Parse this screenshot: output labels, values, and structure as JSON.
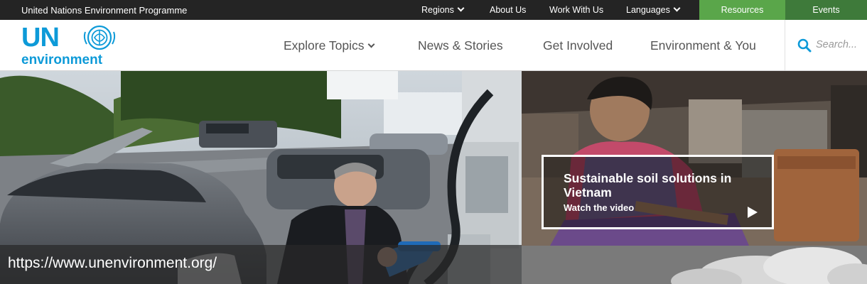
{
  "topbar": {
    "org_name": "United Nations Environment Programme",
    "nav": [
      {
        "label": "Regions",
        "has_dropdown": true
      },
      {
        "label": "About Us",
        "has_dropdown": false
      },
      {
        "label": "Work With Us",
        "has_dropdown": false
      },
      {
        "label": "Languages",
        "has_dropdown": true
      }
    ],
    "resources_label": "Resources",
    "events_label": "Events",
    "resources_color": "#5aa64a",
    "events_color": "#3e7a3a"
  },
  "header": {
    "logo_un": "UN",
    "logo_environment": "environment",
    "brand_color": "#0d9ad8",
    "nav": [
      {
        "label": "Explore Topics",
        "has_dropdown": true
      },
      {
        "label": "News & Stories",
        "has_dropdown": false
      },
      {
        "label": "Get Involved",
        "has_dropdown": false
      },
      {
        "label": "Environment & You",
        "has_dropdown": false
      }
    ],
    "search": {
      "placeholder": "Search...",
      "icon": "search-icon"
    }
  },
  "hero": {
    "video_card": {
      "title": "Sustainable soil solutions in Vietnam",
      "link_label": "Watch the video",
      "icon": "play-icon"
    }
  },
  "url_overlay": "https://www.unenvironment.org/"
}
